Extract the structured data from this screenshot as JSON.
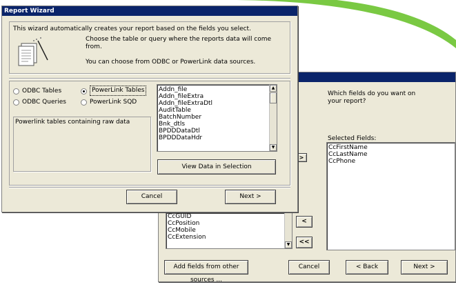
{
  "brand": {
    "swoosh_color": "#7ac943",
    "titlebar_color": "#0a246a"
  },
  "report_wizard": {
    "title": "Report Wizard",
    "intro_text": "This wizard automatically creates your report based on the fields you select.",
    "choose_text": "Choose the table or query where the reports data will come from.",
    "sources_text": "You can choose from ODBC or PowerLink data sources.",
    "wizard_icon": "report-wizard-icon",
    "radio_options": [
      {
        "label": "ODBC Tables",
        "selected": false
      },
      {
        "label": "PowerLink Tables",
        "selected": true
      },
      {
        "label": "ODBC Queries",
        "selected": false
      },
      {
        "label": "PowerLink SQD",
        "selected": false
      }
    ],
    "description": "Powerlink tables containing raw data",
    "tables": [
      "Addn_file",
      "Addn_fileExtra",
      "Addn_fileExtraDtl",
      "AuditTable",
      "BatchNumber",
      "Bnk_dtls",
      "BPDDDataDtl",
      "BPDDDataHdr"
    ],
    "view_data_label": "View Data in Selection",
    "cancel_label": "Cancel",
    "next_label": "Next >"
  },
  "field_dialog": {
    "question": "Which fields do you want on your report?",
    "selected_fields_label": "Selected Fields:",
    "selected_fields": [
      "CcFirstName",
      "CcLastName",
      "CcPhone"
    ],
    "available_fields": [
      "CcGUID",
      "CcPosition",
      "CcMobile",
      "CcExtension"
    ],
    "move_one_right": ">",
    "move_one_left": "<",
    "move_all_left": "<<",
    "add_other_label": "Add fields from other sources ...",
    "cancel_label": "Cancel",
    "back_label": "< Back",
    "next_label": "Next >"
  }
}
